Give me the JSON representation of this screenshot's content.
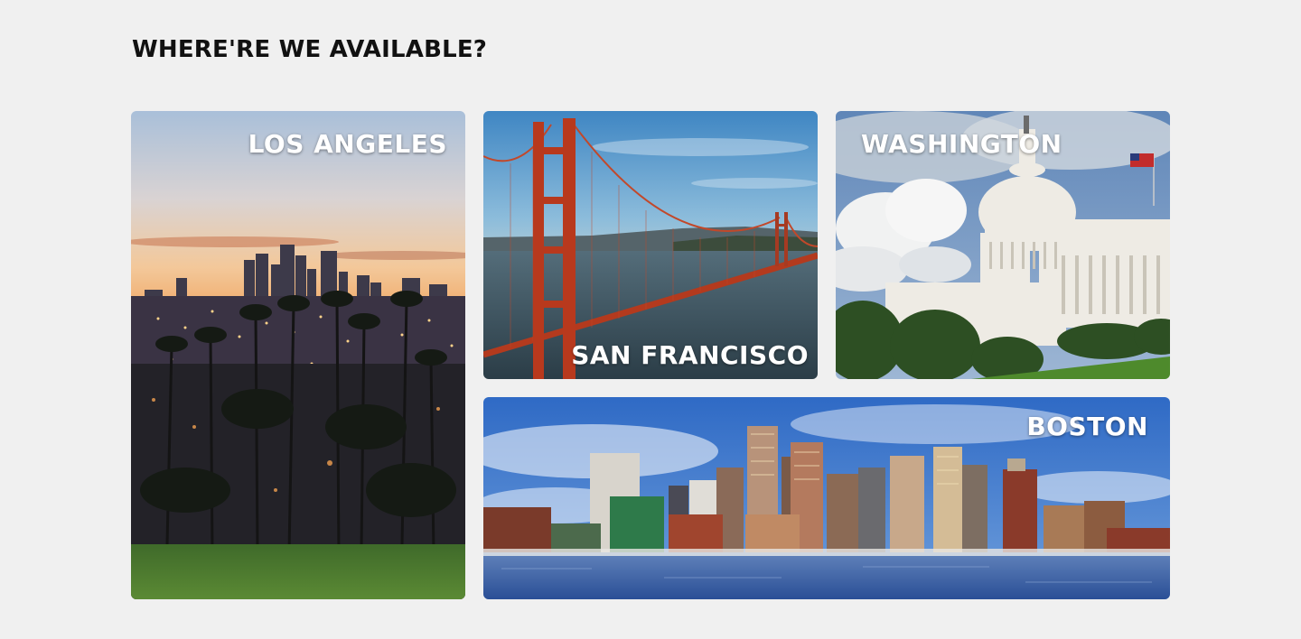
{
  "page": {
    "heading": "WHERE'RE WE AVAILABLE?"
  },
  "cities": {
    "los_angeles": {
      "label": "LOS ANGELES"
    },
    "san_francisco": {
      "label": "SAN FRANCISCO"
    },
    "washington": {
      "label": "WASHINGTON"
    },
    "boston": {
      "label": "BOSTON"
    }
  },
  "colors": {
    "page_background": "#f0f0f0",
    "heading_text": "#111111",
    "label_text": "#ffffff"
  }
}
